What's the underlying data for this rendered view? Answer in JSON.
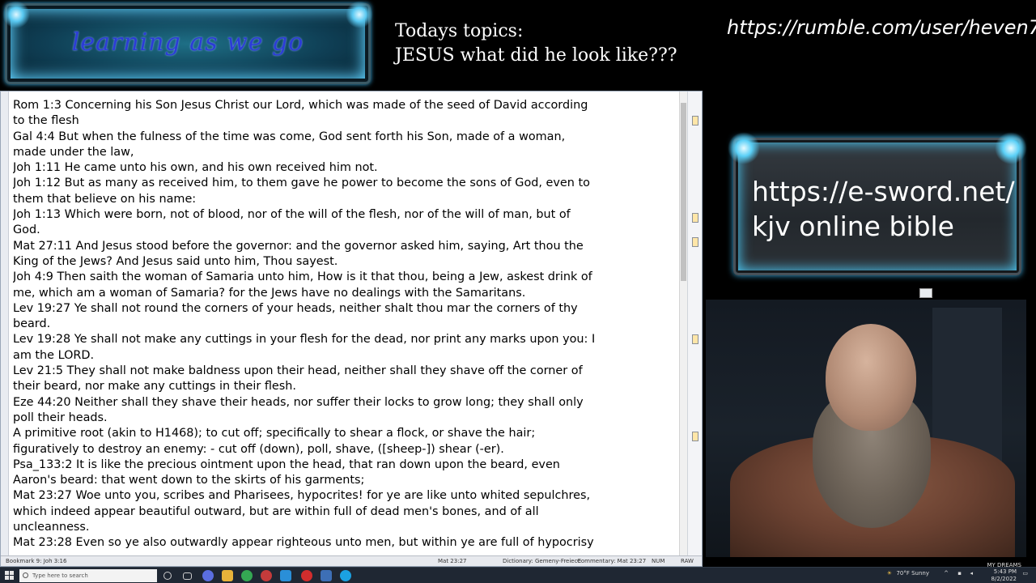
{
  "banner": {
    "title": "learning as we go"
  },
  "topics": {
    "line1": "Todays topics:",
    "line2": "JESUS what did he look like???"
  },
  "rumble_url": "https://rumble.com/user/heven7",
  "verses": [
    "Rom 1:3  Concerning his Son Jesus Christ our Lord, which was made of the seed of David according",
    "to the flesh",
    "Gal 4:4  But when the fulness of the time was come, God sent forth his Son, made of a woman,",
    "made under the law,",
    "Joh 1:11  He came unto his own, and his own received him not.",
    "Joh 1:12  But as many as received him, to them gave he power to become the sons of God, even to",
    "them that believe on his name:",
    "Joh 1:13  Which were born, not of blood, nor of the will of the flesh, nor of the will of man, but of",
    "God.",
    "Mat 27:11  And Jesus stood before the governor: and the governor asked him, saying, Art thou the",
    "King of the Jews? And Jesus said unto him, Thou sayest.",
    "Joh 4:9  Then saith the woman of Samaria unto him, How is it that thou, being a Jew, askest drink of",
    "me, which am a woman of Samaria? for the Jews have no dealings with the Samaritans.",
    "Lev 19:27  Ye shall not round the corners of your heads, neither shalt thou mar the corners of thy",
    "beard.",
    "Lev 19:28  Ye shall not make any cuttings in your flesh for the dead, nor print any marks upon you: I",
    "am the LORD.",
    "Lev 21:5  They shall not make baldness upon their head, neither shall they shave off the corner of",
    "their beard, nor make any cuttings in their flesh.",
    "Eze 44:20  Neither shall they shave their heads, nor suffer their locks to grow long; they shall only",
    "poll their heads.",
    "A primitive root (akin to H1468); to cut off; specifically to shear a flock, or shave the hair;",
    "figuratively to destroy an enemy: - cut off (down), poll, shave, ([sheep-]) shear (-er).",
    "Psa_133:2  It is like the precious ointment upon the head, that ran down upon the beard, even",
    "Aaron's beard: that went down to the skirts of his garments;",
    "Mat 23:27  Woe unto you, scribes and Pharisees, hypocrites! for ye are like unto whited sepulchres,",
    "which indeed appear beautiful outward, but are within full of dead men's bones, and of all",
    "uncleanness.",
    "Mat 23:28  Even so ye also outwardly appear righteous unto men, but within ye are full of hypocrisy"
  ],
  "statusbar": {
    "bookmark": "Bookmark 9: Joh 3:16",
    "verse": "Mat 23:27",
    "dictionary": "Dictionary: Gemeny-Freiece",
    "commentary": "Commentary: Mat 23:27",
    "num": "NUM",
    "raw": "RAW"
  },
  "link_panel": {
    "line1": "https://e-sword.net/",
    "line2": "kjv online bible"
  },
  "webcam": {
    "watermark": "MY DREAMS"
  },
  "taskbar": {
    "search_placeholder": "Type here to search",
    "weather": "70°F Sunny",
    "time": "5:43 PM",
    "date": "8/2/2022"
  },
  "colors": {
    "banner_title": "#2c3cd6",
    "glow": "#4cc8f4",
    "text_bg": "#ffffff"
  }
}
